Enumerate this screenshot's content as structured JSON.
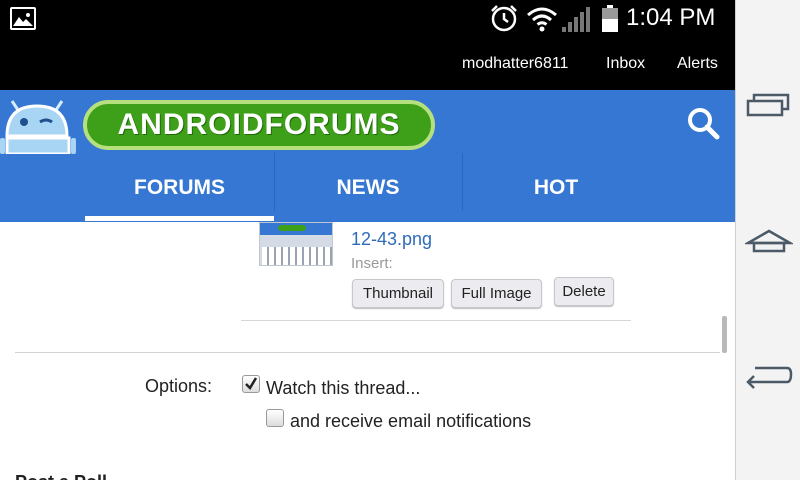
{
  "status_bar": {
    "time": "1:04 PM",
    "icons": [
      "gallery-icon",
      "alarm-icon",
      "wifi-icon",
      "signal-icon",
      "battery-icon"
    ]
  },
  "user_bar": {
    "username": "modhatter6811",
    "inbox": "Inbox",
    "alerts": "Alerts"
  },
  "header": {
    "logo_text": "ANDROIDFORUMS",
    "tabs": [
      {
        "label": "FORUMS",
        "active": true
      },
      {
        "label": "NEWS",
        "active": false
      },
      {
        "label": "HOT",
        "active": false
      }
    ],
    "colors": {
      "header": "#3577d2",
      "logo": "#3e9f19"
    }
  },
  "attachment": {
    "file_name": "12-43.png",
    "insert_label": "Insert:",
    "buttons": {
      "thumbnail": "Thumbnail",
      "full_image": "Full Image",
      "delete": "Delete"
    }
  },
  "options": {
    "label": "Options:",
    "watch": {
      "label": "Watch this thread...",
      "checked": true
    },
    "email": {
      "label": "and receive email notifications",
      "checked": false
    }
  },
  "poll": {
    "heading": "Post a Poll"
  },
  "nav_bar": {
    "icons": [
      "recent-apps-icon",
      "home-icon",
      "back-icon"
    ]
  }
}
